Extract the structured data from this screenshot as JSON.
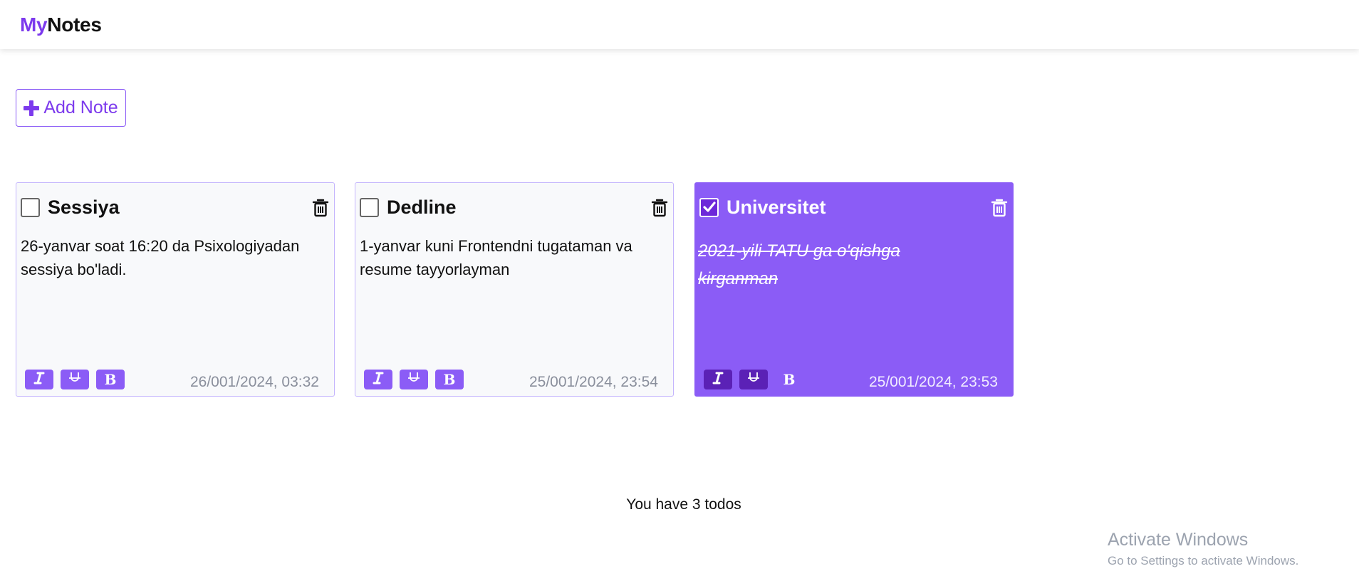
{
  "header": {
    "logo_my": "My",
    "logo_notes": "Notes"
  },
  "actions": {
    "add_label": "Add Note"
  },
  "notes": [
    {
      "title": "Sessiya",
      "body": "26-yanvar soat 16:20 da Psixologiyadan sessiya bo'ladi.",
      "date": "26/001/2024, 03:32",
      "done": false
    },
    {
      "title": "Dedline",
      "body": "1-yanvar kuni Frontendni tugataman va resume tayyorlayman",
      "date": "25/001/2024, 23:54",
      "done": false
    },
    {
      "title": "Universitet",
      "body": "2021-yili TATU ga o'qishga kirganman",
      "date": "25/001/2024, 23:53",
      "done": true
    }
  ],
  "format_buttons": {
    "italic": "I",
    "strike": "U",
    "bold": "B"
  },
  "footer": {
    "count_text": "You have 3 todos"
  },
  "watermark": {
    "title": "Activate Windows",
    "subtitle": "Go to Settings to activate Windows."
  },
  "colors": {
    "accent": "#8b5cf6",
    "accent_dark": "#5b21b6",
    "brand": "#7c3aed"
  }
}
